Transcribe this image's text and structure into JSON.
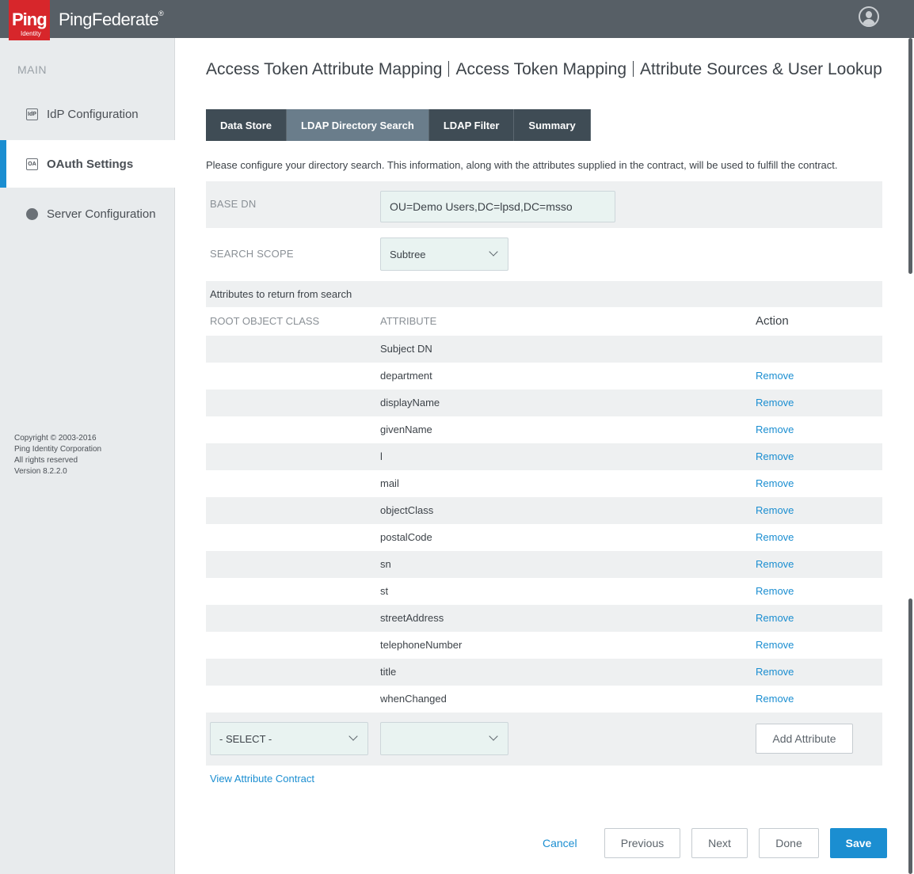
{
  "header": {
    "logo_text": "Ping",
    "logo_subtext": "Identity",
    "product_name": "PingFederate",
    "product_reg": "®",
    "user_icon": "user-avatar-icon"
  },
  "sidebar": {
    "section_label": "MAIN",
    "items": [
      {
        "label": "IdP Configuration",
        "icon": "idp-icon",
        "icon_text": "IdP"
      },
      {
        "label": "OAuth Settings",
        "icon": "oauth-icon",
        "icon_text": "OA"
      },
      {
        "label": "Server Configuration",
        "icon": "server-icon",
        "icon_text": ""
      }
    ],
    "copyright_lines": [
      "Copyright © 2003-2016",
      "Ping Identity Corporation",
      "All rights reserved",
      "Version 8.2.2.0"
    ]
  },
  "breadcrumb": {
    "parts": [
      "Access Token Attribute Mapping",
      "Access Token Mapping",
      "Attribute Sources & User Lookup"
    ]
  },
  "tabs": [
    {
      "label": "Data Store",
      "active": false
    },
    {
      "label": "LDAP Directory Search",
      "active": true
    },
    {
      "label": "LDAP Filter",
      "active": false
    },
    {
      "label": "Summary",
      "active": false
    }
  ],
  "description": "Please configure your directory search. This information, along with the attributes supplied in the contract, will be used to fulfill the contract.",
  "form": {
    "base_dn_label": "BASE DN",
    "base_dn_value": "OU=Demo Users,DC=lpsd,DC=msso",
    "search_scope_label": "SEARCH SCOPE",
    "search_scope_value": "Subtree"
  },
  "attributes": {
    "section_title": "Attributes to return from search",
    "col_root": "ROOT OBJECT CLASS",
    "col_attribute": "ATTRIBUTE",
    "col_action": "Action",
    "remove_label": "Remove",
    "rows": [
      "Subject DN",
      "department",
      "displayName",
      "givenName",
      "l",
      "mail",
      "objectClass",
      "postalCode",
      "sn",
      "st",
      "streetAddress",
      "telephoneNumber",
      "title",
      "whenChanged"
    ],
    "select_placeholder": "- SELECT -",
    "add_button": "Add Attribute",
    "view_contract_link": "View Attribute Contract"
  },
  "footer": {
    "cancel": "Cancel",
    "previous": "Previous",
    "next": "Next",
    "done": "Done",
    "save": "Save"
  },
  "colors": {
    "accent": "#1b8ed1",
    "brand_red": "#d7262b",
    "topbar": "#575f66",
    "tab_dark": "#3f4c55",
    "tab_active": "#6a7d8b"
  }
}
